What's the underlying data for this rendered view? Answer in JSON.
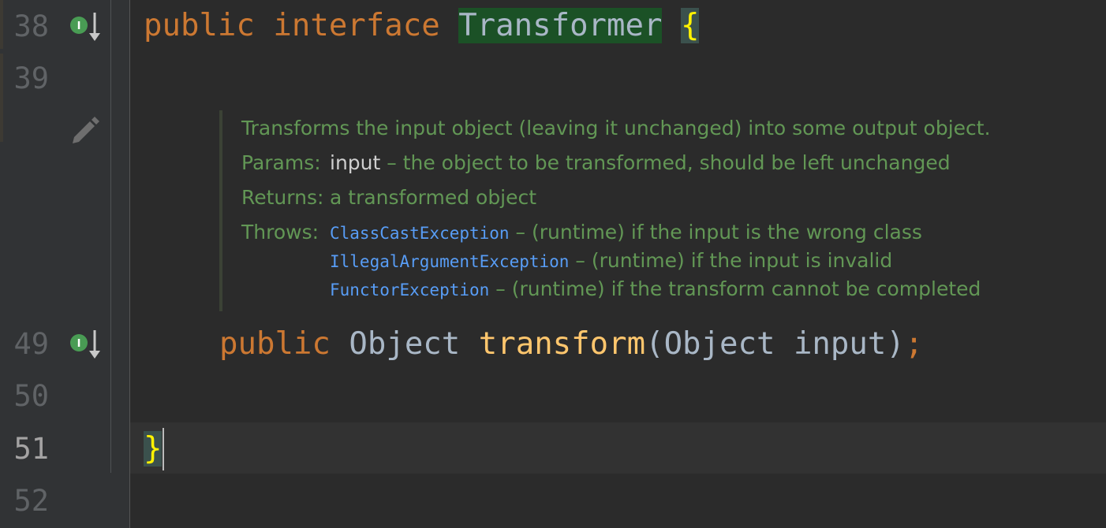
{
  "gutter": {
    "line_numbers": [
      "38",
      "39",
      "49",
      "50",
      "51",
      "52"
    ],
    "current_line": "51",
    "icons": [
      "implemented-interface-icon",
      "implemented-method-icon",
      "edit-doc-pencil-icon"
    ]
  },
  "code": {
    "line38": {
      "kw1": "public",
      "kw2": "interface",
      "class_name": "Transformer",
      "open_brace": "{"
    },
    "line49": {
      "kw": "public",
      "ret_type": "Object",
      "method": "transform",
      "open_paren": "(",
      "param_type": "Object",
      "param_name": "input",
      "close": ")",
      "semicolon": ";"
    },
    "line51": {
      "close_brace": "}"
    }
  },
  "javadoc": {
    "summary": "Transforms the input object (leaving it unchanged) into some output object.",
    "params_label": "Params:",
    "param_name": "input",
    "param_desc": " – the object to be transformed, should be left unchanged",
    "returns_label": "Returns:",
    "returns_desc": "a transformed object",
    "throws_label": "Throws:",
    "throws": [
      {
        "exception": "ClassCastException",
        "desc": " – (runtime) if the input is the wrong class"
      },
      {
        "exception": "IllegalArgumentException",
        "desc": " – (runtime) if the input is invalid"
      },
      {
        "exception": "FunctorException",
        "desc": " – (runtime) if the transform cannot be completed"
      }
    ]
  },
  "colors": {
    "background": "#2b2b2b",
    "keyword": "#cc7832",
    "method": "#ffc66d",
    "brace": "#fff200",
    "doc_text": "#629755",
    "doc_link": "#589df6",
    "identifier_highlight": "#1b5126"
  }
}
